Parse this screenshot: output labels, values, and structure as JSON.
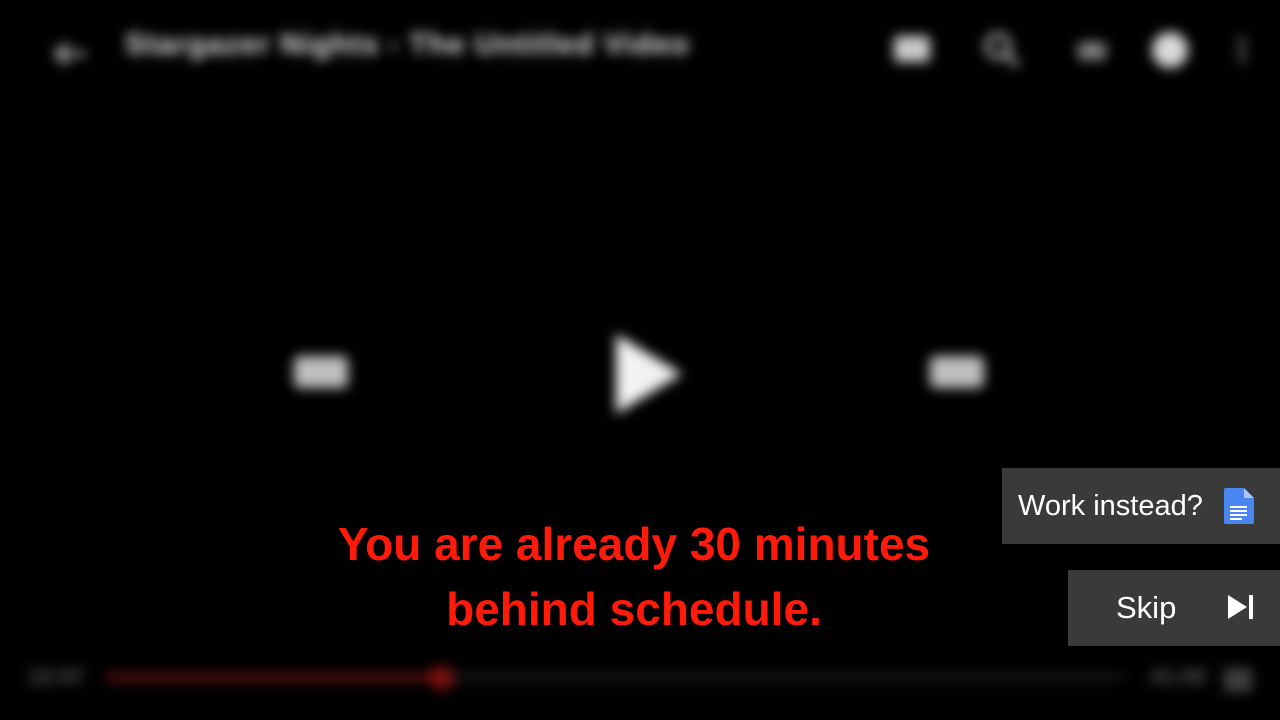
{
  "player": {
    "title": "Stargazer Nights - The Untitled Video",
    "top_icons": [
      "cast-icon",
      "search-icon",
      "captions-icon",
      "account-icon",
      "more-vert-icon"
    ],
    "controls": {
      "rewind_icon": "rewind-10-icon",
      "play_icon": "play-icon",
      "forward_icon": "forward-10-icon"
    },
    "elapsed": "12:07",
    "duration": "41:00",
    "progress_fraction": 0.33
  },
  "overlay": {
    "message_line1": "You are already 30 minutes",
    "message_line2": "behind schedule.",
    "message_color": "#ff1a0a"
  },
  "actions": {
    "work_label": "Work instead?",
    "work_icon": "google-docs-icon",
    "skip_label": "Skip",
    "skip_icon": "skip-next-icon"
  }
}
